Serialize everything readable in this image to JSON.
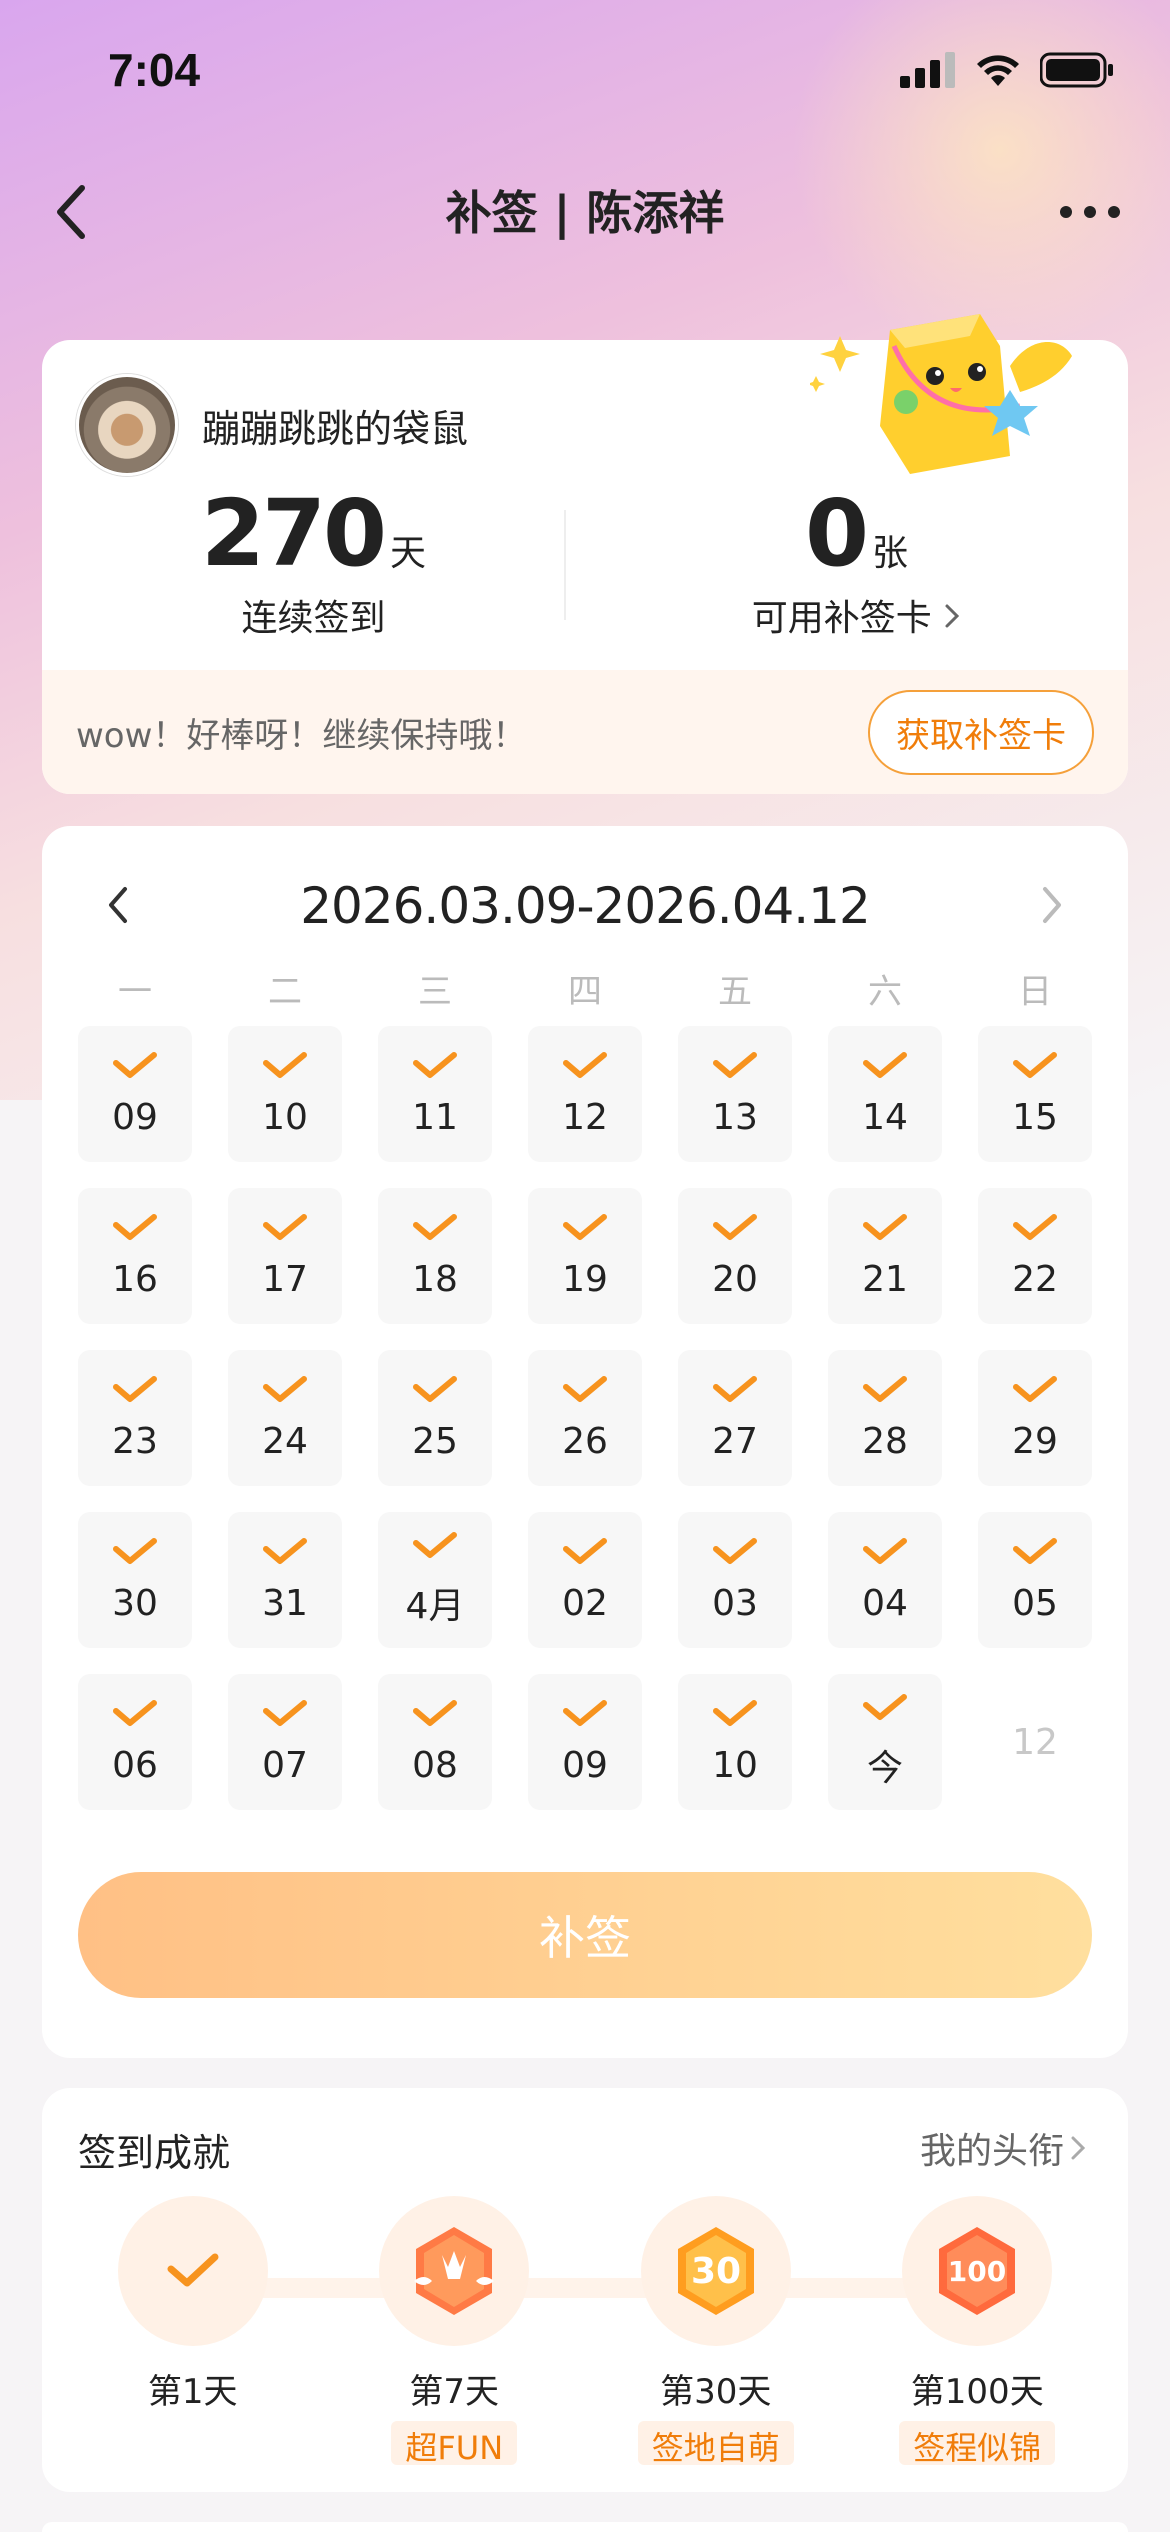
{
  "status_bar": {
    "time": "7:04"
  },
  "nav": {
    "title": "补签 | 陈添祥"
  },
  "user": {
    "name": "蹦蹦跳跳的袋鼠",
    "streak_value": "270",
    "streak_unit": "天",
    "streak_label": "连续签到",
    "cards_value": "0",
    "cards_unit": "张",
    "cards_label": "可用补签卡",
    "banner_text": "wow！好棒呀！继续保持哦！",
    "get_card_label": "获取补签卡"
  },
  "calendar": {
    "range": "2026.03.09-2026.04.12",
    "weekdays": [
      "一",
      "二",
      "三",
      "四",
      "五",
      "六",
      "日"
    ],
    "days": [
      {
        "label": "09",
        "checked": true
      },
      {
        "label": "10",
        "checked": true
      },
      {
        "label": "11",
        "checked": true
      },
      {
        "label": "12",
        "checked": true
      },
      {
        "label": "13",
        "checked": true
      },
      {
        "label": "14",
        "checked": true
      },
      {
        "label": "15",
        "checked": true
      },
      {
        "label": "16",
        "checked": true
      },
      {
        "label": "17",
        "checked": true
      },
      {
        "label": "18",
        "checked": true
      },
      {
        "label": "19",
        "checked": true
      },
      {
        "label": "20",
        "checked": true
      },
      {
        "label": "21",
        "checked": true
      },
      {
        "label": "22",
        "checked": true
      },
      {
        "label": "23",
        "checked": true
      },
      {
        "label": "24",
        "checked": true
      },
      {
        "label": "25",
        "checked": true
      },
      {
        "label": "26",
        "checked": true
      },
      {
        "label": "27",
        "checked": true
      },
      {
        "label": "28",
        "checked": true
      },
      {
        "label": "29",
        "checked": true
      },
      {
        "label": "30",
        "checked": true
      },
      {
        "label": "31",
        "checked": true
      },
      {
        "label": "4月",
        "checked": true
      },
      {
        "label": "02",
        "checked": true
      },
      {
        "label": "03",
        "checked": true
      },
      {
        "label": "04",
        "checked": true
      },
      {
        "label": "05",
        "checked": true
      },
      {
        "label": "06",
        "checked": true
      },
      {
        "label": "07",
        "checked": true
      },
      {
        "label": "08",
        "checked": true
      },
      {
        "label": "09",
        "checked": true
      },
      {
        "label": "10",
        "checked": true
      },
      {
        "label": "今",
        "checked": true
      },
      {
        "label": "12",
        "checked": false
      }
    ],
    "make_up_label": "补签"
  },
  "achievements": {
    "title": "签到成就",
    "link_label": "我的头衔",
    "items": [
      {
        "day": "第1天",
        "tag": "",
        "icon": "check-badge-icon"
      },
      {
        "day": "第7天",
        "tag": "超FUN",
        "icon": "hand-badge-icon"
      },
      {
        "day": "第30天",
        "tag": "签地自萌",
        "icon": "30-days-badge-icon"
      },
      {
        "day": "第100天",
        "tag": "签程似锦",
        "icon": "100-days-badge-icon"
      }
    ]
  },
  "colors": {
    "accent": "#f5900f",
    "check": "#f7931e",
    "button_start": "#ffc085",
    "button_end": "#ffdf9e"
  }
}
